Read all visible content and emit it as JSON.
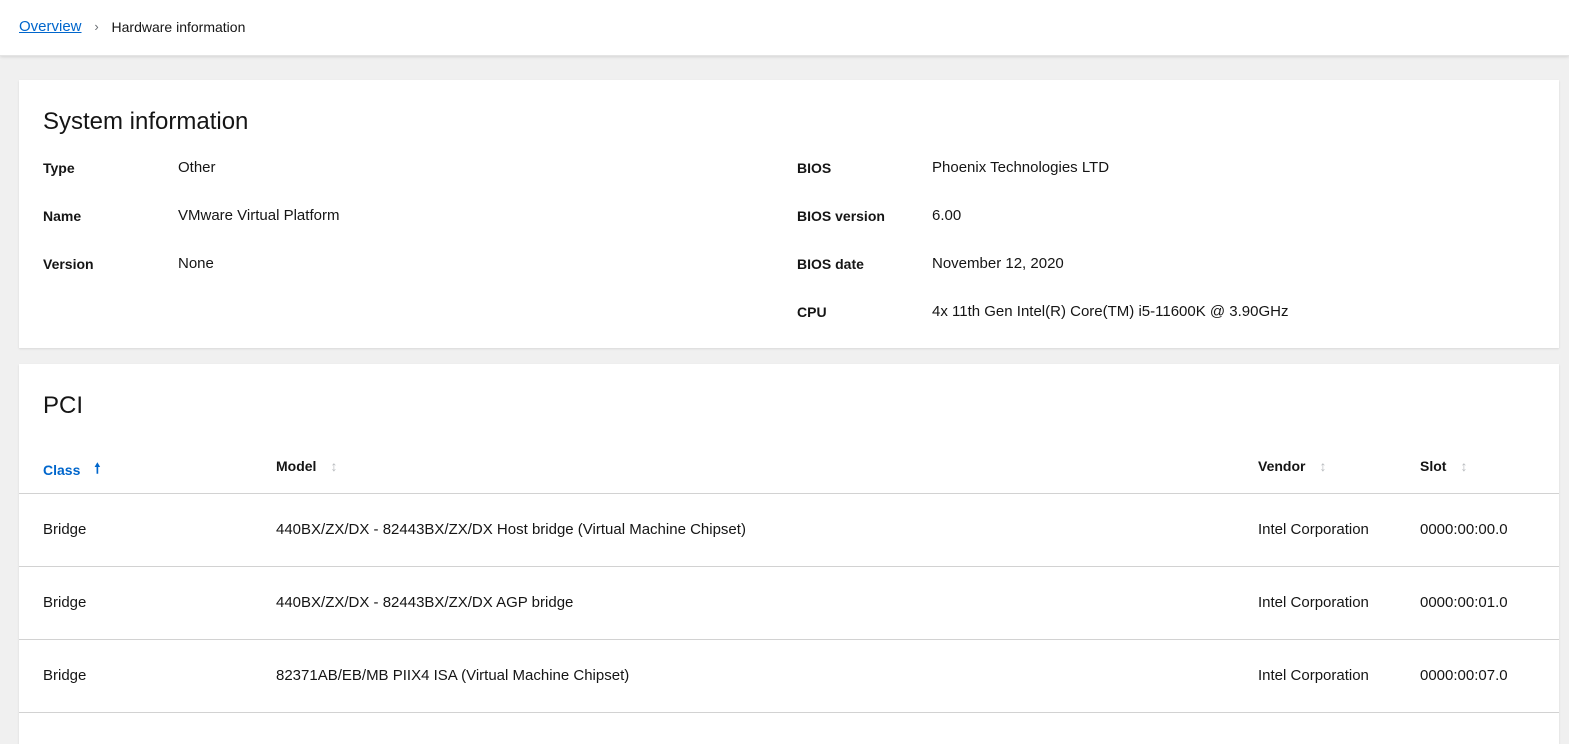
{
  "breadcrumb": {
    "parent": "Overview",
    "separator": "›",
    "current": "Hardware information"
  },
  "system_info": {
    "title": "System information",
    "left": [
      {
        "label": "Type",
        "value": "Other"
      },
      {
        "label": "Name",
        "value": "VMware Virtual Platform"
      },
      {
        "label": "Version",
        "value": "None"
      }
    ],
    "right": [
      {
        "label": "BIOS",
        "value": "Phoenix Technologies LTD"
      },
      {
        "label": "BIOS version",
        "value": "6.00"
      },
      {
        "label": "BIOS date",
        "value": "November 12, 2020"
      },
      {
        "label": "CPU",
        "value": "4x 11th Gen Intel(R) Core(TM) i5-11600K @ 3.90GHz"
      }
    ]
  },
  "pci": {
    "title": "PCI",
    "columns": [
      {
        "label": "Class",
        "sort": "ascending",
        "icon": "sort-up-arrow-icon"
      },
      {
        "label": "Model",
        "sort": "none",
        "icon": "sort-both-icon"
      },
      {
        "label": "Vendor",
        "sort": "none",
        "icon": "sort-both-icon"
      },
      {
        "label": "Slot",
        "sort": "none",
        "icon": "sort-both-icon"
      }
    ],
    "rows": [
      {
        "class": "Bridge",
        "model": "440BX/ZX/DX - 82443BX/ZX/DX Host bridge (Virtual Machine Chipset)",
        "vendor": "Intel Corporation",
        "slot": "0000:00:00.0"
      },
      {
        "class": "Bridge",
        "model": "440BX/ZX/DX - 82443BX/ZX/DX AGP bridge",
        "vendor": "Intel Corporation",
        "slot": "0000:00:01.0"
      },
      {
        "class": "Bridge",
        "model": "82371AB/EB/MB PIIX4 ISA (Virtual Machine Chipset)",
        "vendor": "Intel Corporation",
        "slot": "0000:00:07.0"
      }
    ]
  },
  "colors": {
    "link": "#0066cc",
    "background": "#f0f0f0",
    "card": "#ffffff",
    "border": "#d2d2d2"
  }
}
